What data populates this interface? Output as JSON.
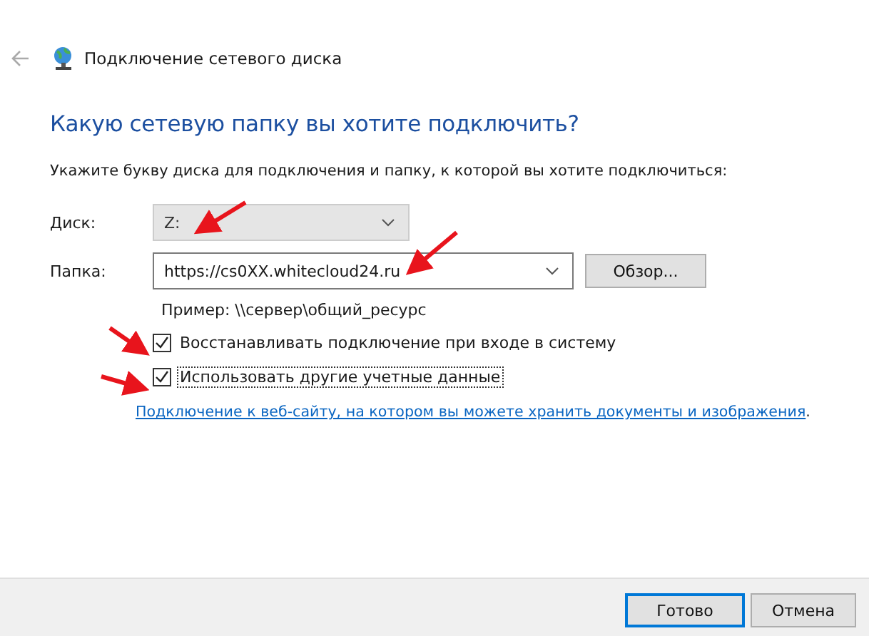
{
  "window": {
    "title": "Подключение сетевого диска"
  },
  "heading": "Какую сетевую папку вы хотите подключить?",
  "instruction": "Укажите букву диска для подключения и папку, к которой вы хотите подключиться:",
  "drive": {
    "label": "Диск:",
    "value": "Z:",
    "disabled": true
  },
  "folder": {
    "label": "Папка:",
    "value": "https://cs0XX.whitecloud24.ru",
    "browse_button": "Обзор..."
  },
  "example": "Пример: \\\\сервер\\общий_ресурс",
  "options": [
    {
      "label": "Восстанавливать подключение при входе в систему",
      "checked": true,
      "focused": false
    },
    {
      "label": "Использовать другие учетные данные",
      "checked": true,
      "focused": true
    }
  ],
  "link": "Подключение к веб-сайту, на котором вы можете хранить документы и изображения",
  "link_suffix": ".",
  "buttons": [
    {
      "label": "Готово",
      "default": true
    },
    {
      "label": "Отмена",
      "default": false
    }
  ],
  "annotation_arrows": [
    {
      "kind": "arrow"
    },
    {
      "kind": "arrow"
    },
    {
      "kind": "arrow"
    },
    {
      "kind": "arrow"
    }
  ]
}
